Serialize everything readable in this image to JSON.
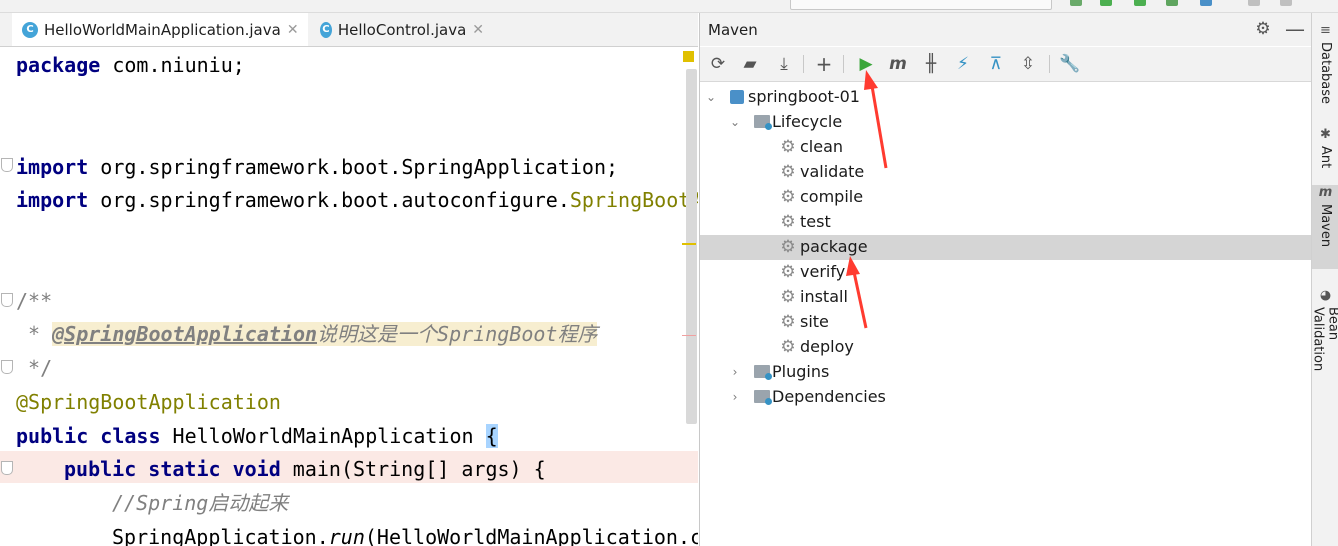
{
  "tabs": [
    {
      "label": "HelloWorldMainApplication.java",
      "icon": "spring-class-icon",
      "active": true
    },
    {
      "label": "HelloControl.java",
      "icon": "class-icon",
      "active": false
    }
  ],
  "code": {
    "line1": {
      "kw": "package",
      "rest": " com.niuniu;"
    },
    "line2": {
      "kw": "import",
      "rest": " org.springframework.boot.SpringApplication;"
    },
    "line3": {
      "kw": "import",
      "rest": " org.springframework.boot.autoconfigure.",
      "tail": "SpringBootA"
    },
    "line4": "/**",
    "line5": {
      "prefix": " * ",
      "tag": "@SpringBootApplication",
      "text": "说明这是一个SpringBoot程序"
    },
    "line6": " */",
    "line7": "@SpringBootApplication",
    "line8": {
      "kw": "public class",
      "name": " HelloWorldMainApplication ",
      "brace": "{"
    },
    "line9": {
      "kw": "public static void",
      "rest": " main(String[] args) {"
    },
    "line10": "//Spring启动起来",
    "line11": {
      "pre": "SpringApplication.",
      "call": "run",
      "rest": "(HelloWorldMainApplication.c"
    }
  },
  "maven": {
    "title": "Maven",
    "tree": {
      "project": "springboot-01",
      "lifecycle": "Lifecycle",
      "phases": [
        "clean",
        "validate",
        "compile",
        "test",
        "package",
        "verify",
        "install",
        "site",
        "deploy"
      ],
      "selected_phase": "package",
      "plugins": "Plugins",
      "dependencies": "Dependencies"
    }
  },
  "sidebar": [
    "Database",
    "Ant",
    "Maven",
    "Bean Validation"
  ],
  "colors": {
    "accent_run": "#3aa63a",
    "annotation_arrow": "#ff3b30",
    "selection": "#d5d5d5"
  }
}
